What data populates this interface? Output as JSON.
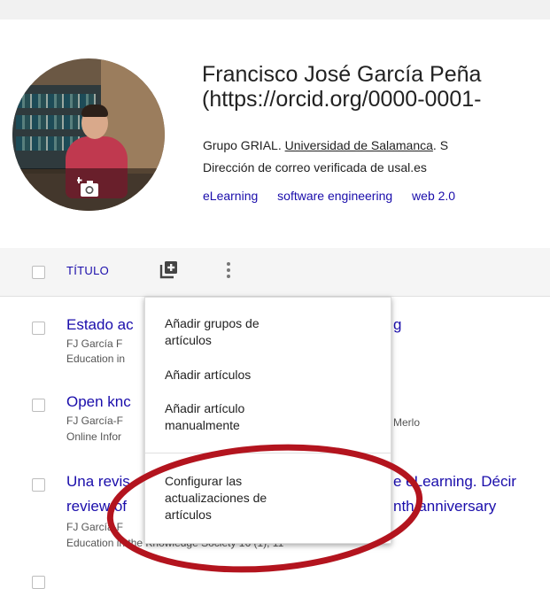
{
  "profile": {
    "name_line1": "Francisco José García Peña",
    "name_line2": "(https://orcid.org/0000-0001-",
    "affiliation_prefix": "Grupo GRIAL. ",
    "affiliation_link": "Universidad de Salamanca",
    "affiliation_suffix": ". S",
    "email": "Dirección de correo verificada de usal.es",
    "tags": [
      "eLearning",
      "software engineering",
      "web 2.0"
    ]
  },
  "list_header": {
    "title_column": "TÍTULO",
    "add_icon": "add-collection-icon",
    "more_icon": "more-vert-icon"
  },
  "rows": [
    {
      "title": "Estado ac",
      "title_tail": "g",
      "authors": "FJ García F",
      "venue": "Education in"
    },
    {
      "title": "Open knc",
      "authors": "FJ García-F",
      "authors_tail": "Merlo",
      "venue": "Online Infor"
    },
    {
      "title": "Una revis",
      "title_tail": "e eLearning. Décir",
      "title2": "review of",
      "title2_tail": "nth anniversary",
      "authors": "FJ García-F",
      "venue": "Education in the Knowledge Society 16 (1), 11"
    }
  ],
  "menu": {
    "items": [
      "Añadir grupos de artículos",
      "Añadir artículos",
      "Añadir artículo manualmente",
      "Configurar las actualizaciones de artículos"
    ]
  },
  "colors": {
    "link": "#1a0dab",
    "highlight_ellipse": "#b3141e"
  }
}
